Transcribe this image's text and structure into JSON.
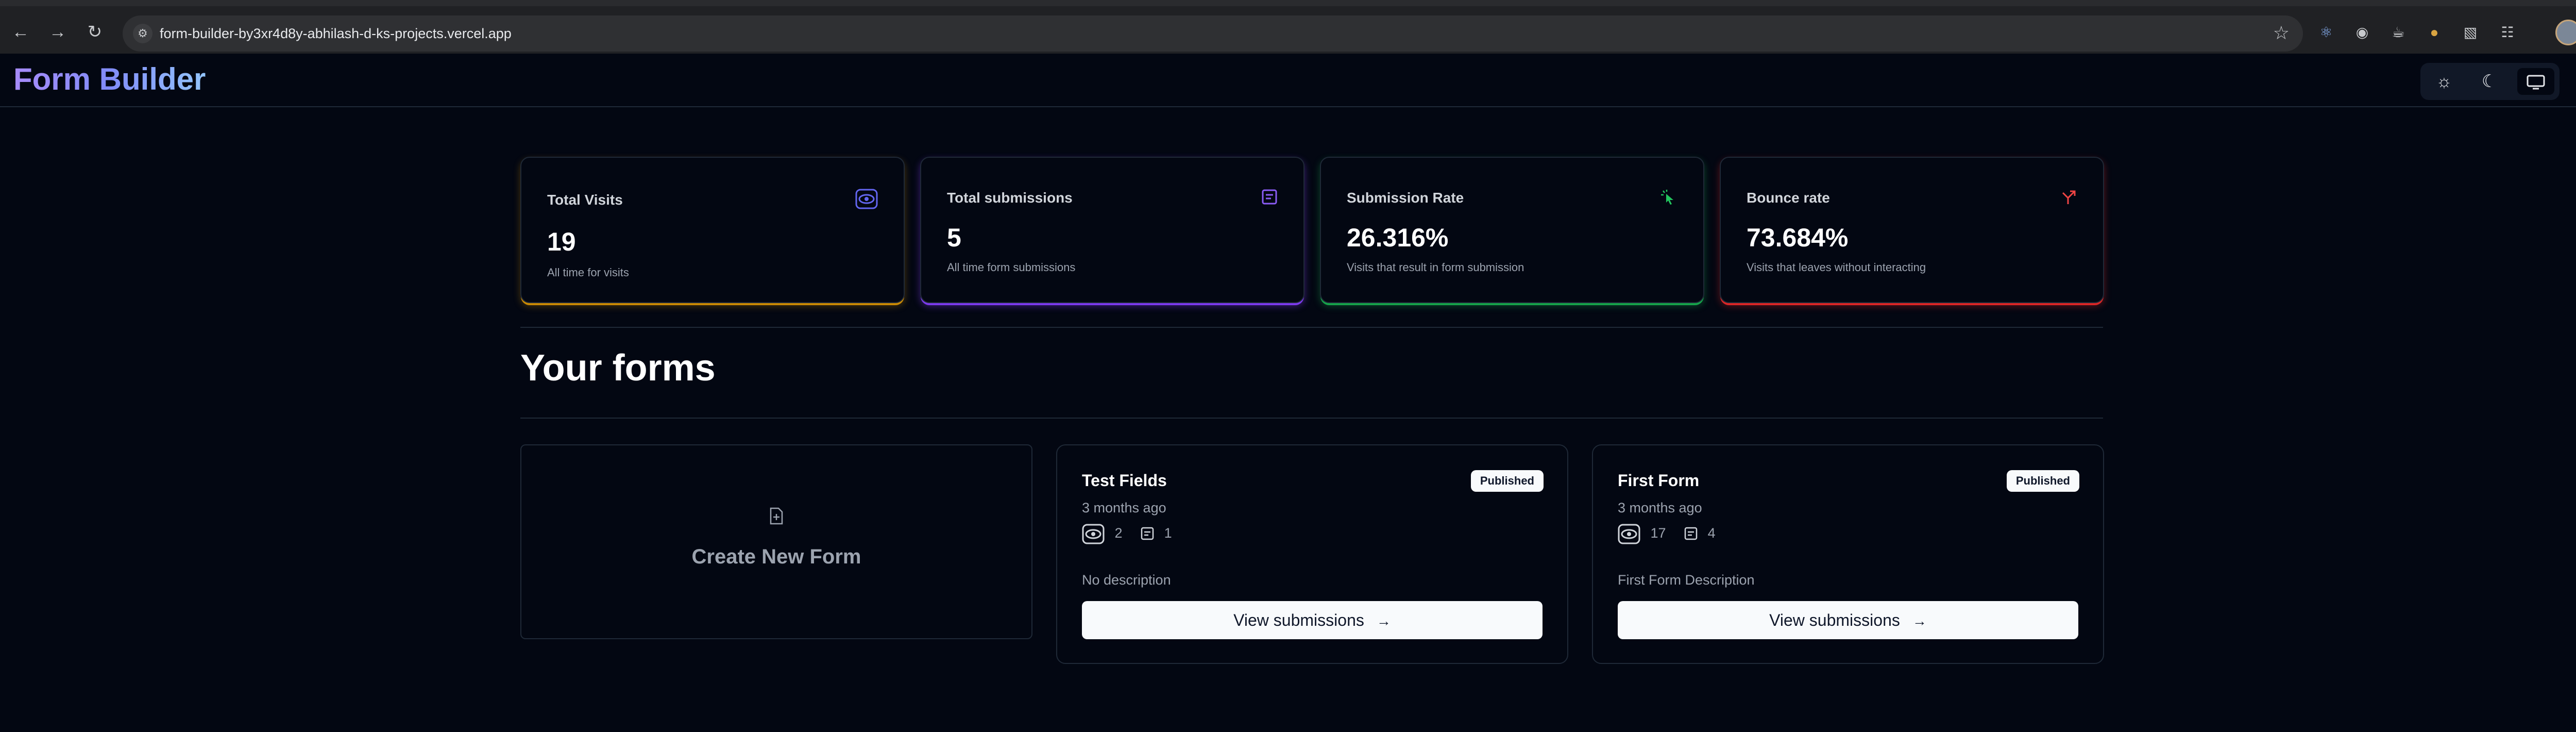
{
  "browser": {
    "url": "form-builder-by3xr4d8y-abhilash-d-ks-projects.vercel.app",
    "back_icon": "arrow-left",
    "forward_icon": "arrow-right",
    "reload_icon": "reload",
    "bookmark_icon": "star"
  },
  "app": {
    "title": "Form Builder",
    "theme_modes": [
      "light",
      "dark",
      "system"
    ],
    "active_theme": "system"
  },
  "stats": [
    {
      "title": "Total Visits",
      "value": "19",
      "description": "All time for visits",
      "accent": "#ca8a04",
      "icon": "eye-icon"
    },
    {
      "title": "Total submissions",
      "value": "5",
      "description": "All time form submissions",
      "accent": "#7c3aed",
      "icon": "form-icon"
    },
    {
      "title": "Submission Rate",
      "value": "26.316%",
      "description": "Visits that result in form submission",
      "accent": "#16a34a",
      "icon": "pointer-icon"
    },
    {
      "title": "Bounce rate",
      "value": "73.684%",
      "description": "Visits that leaves without interacting",
      "accent": "#dc2626",
      "icon": "split-icon"
    }
  ],
  "forms_section": {
    "title": "Your forms",
    "create_label": "Create New Form"
  },
  "forms": [
    {
      "name": "Test Fields",
      "status": "Published",
      "date": "3 months ago",
      "visits": "2",
      "submissions": "1",
      "description": "No description",
      "action": "View submissions"
    },
    {
      "name": "First Form",
      "status": "Published",
      "date": "3 months ago",
      "visits": "17",
      "submissions": "4",
      "description": "First Form Description",
      "action": "View submissions"
    }
  ]
}
